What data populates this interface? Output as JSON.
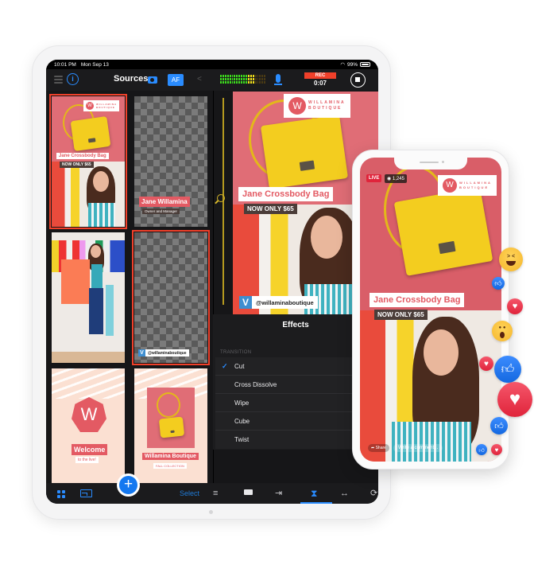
{
  "status_bar": {
    "time": "10:01 PM",
    "date": "Mon Sep 13",
    "battery": "99%"
  },
  "toolbar": {
    "title": "Sources",
    "af_label": "AF",
    "rec_label": "REC",
    "rec_time": "0:07",
    "audio_level": {
      "green_fraction": 0.6,
      "yellow_fraction": 0.15,
      "peak_fraction": 0.75
    }
  },
  "sources": [
    {
      "type": "product",
      "selected": true,
      "brand_line1": "WILLAMINA",
      "brand_line2": "BOUTIQUE",
      "title": "Jane Crossbody Bag",
      "price": "NOW ONLY $65"
    },
    {
      "type": "lower-third",
      "selected": false,
      "name": "Jane Willamina",
      "role": "Owner and Manager"
    },
    {
      "type": "photo",
      "selected": false
    },
    {
      "type": "social-tag",
      "selected": true,
      "handle": "@willaminaboutique"
    },
    {
      "type": "welcome",
      "selected": false,
      "logo_letter": "W",
      "title": "Welcome",
      "subtitle": "to the live!"
    },
    {
      "type": "collection",
      "selected": false,
      "title": "Willamina Boutique",
      "subtitle": "FALL COLLECTION"
    }
  ],
  "preview": {
    "brand_letter": "W",
    "brand_line1": "WILLAMINA",
    "brand_line2": "BOUTIQUE",
    "title": "Jane Crossbody Bag",
    "price": "NOW ONLY $65",
    "handle": "@willaminaboutique",
    "v_letter": "V"
  },
  "effects": {
    "title": "Effects",
    "section": "TRANSITION",
    "items": [
      {
        "label": "Cut",
        "checked": true
      },
      {
        "label": "Cross Dissolve",
        "checked": false
      },
      {
        "label": "Wipe",
        "checked": false
      },
      {
        "label": "Cube",
        "checked": false
      },
      {
        "label": "Twist",
        "checked": false
      }
    ]
  },
  "bottom_bar": {
    "add_label": "+",
    "select_label": "Select",
    "icons": [
      "grid-icon",
      "layout-icon",
      "adjustments-icon",
      "camera-icon",
      "output-icon",
      "transition-icon",
      "audio-icon",
      "loop-icon"
    ],
    "active_tab": "transition-icon"
  },
  "phone": {
    "live_label": "LIVE",
    "viewers": "1,245",
    "title": "Jane Crossbody Bag",
    "price": "NOW ONLY $65",
    "share_label": "Share",
    "comment_placeholder": "Write a comment...",
    "brand_letter": "W",
    "brand_line1": "WILLAMINA",
    "brand_line2": "BOUTIQUE"
  },
  "reactions": [
    "haha",
    "like",
    "love",
    "wow",
    "love",
    "like",
    "love",
    "like",
    "like",
    "love"
  ],
  "colors": {
    "accent": "#2a8cff",
    "record": "#f0402a",
    "brand_pink": "#e35a63",
    "bag_yellow": "#f3cd1f"
  }
}
